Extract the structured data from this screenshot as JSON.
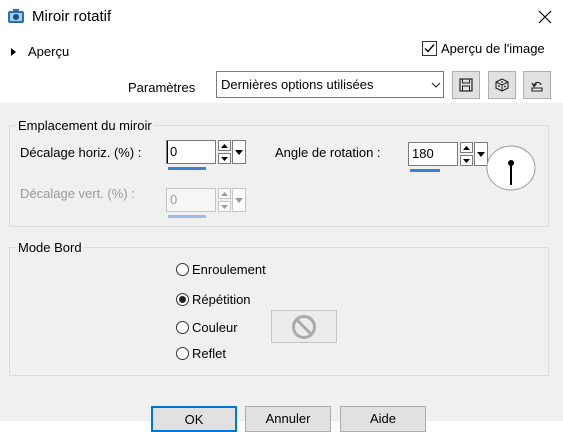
{
  "window": {
    "title": "Miroir rotatif",
    "close_glyph": "✕"
  },
  "apercu": {
    "label": "Aperçu",
    "preview_image_label": "Aperçu de l'image",
    "preview_image_checked": true
  },
  "parametres": {
    "label": "Paramètres",
    "selected": "Dernières options utilisées",
    "buttons": [
      "save-icon",
      "random-dice-icon",
      "reset-icon"
    ]
  },
  "emplacement": {
    "group_title": "Emplacement du miroir",
    "horiz_label": "Décalage horiz. (%) :",
    "horiz_value": "0",
    "vert_label": "Décalage vert. (%) :",
    "vert_value": "0",
    "vert_enabled": false,
    "angle_label": "Angle de rotation :",
    "angle_value": "180"
  },
  "mode_bord": {
    "group_title": "Mode Bord",
    "options": [
      "Enroulement",
      "Répétition",
      "Couleur",
      "Reflet"
    ],
    "selected": "Répétition"
  },
  "buttons": {
    "ok": "OK",
    "cancel": "Annuler",
    "help": "Aide"
  },
  "colors": {
    "accent": "#0078d7",
    "panel_bg": "#f0f0f0"
  }
}
